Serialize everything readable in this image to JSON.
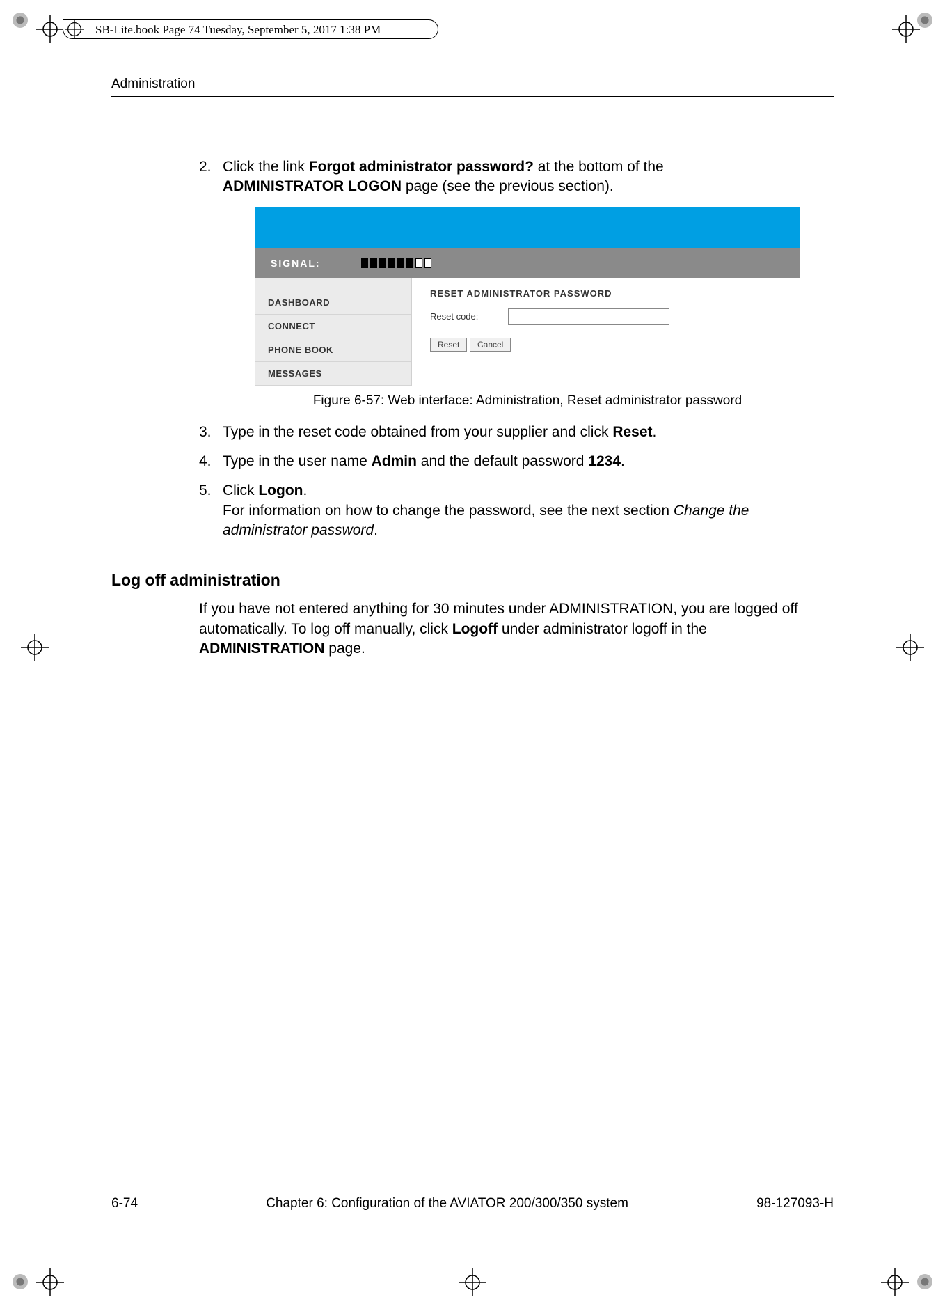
{
  "printMeta": {
    "tabText": "SB-Lite.book  Page 74  Tuesday, September 5, 2017  1:38 PM"
  },
  "header": {
    "runningHead": "Administration"
  },
  "steps": {
    "s2": {
      "num": "2.",
      "pre": "Click the link ",
      "bold1": "Forgot administrator password?",
      "mid": " at the bottom of the ",
      "bold2": "ADMINISTRATOR LOGON",
      "post": " page (see the previous section)."
    },
    "s3": {
      "num": "3.",
      "pre": "Type in the reset code obtained from your supplier and click ",
      "bold1": "Reset",
      "post": "."
    },
    "s4": {
      "num": "4.",
      "pre": "Type in the user name ",
      "bold1": "Admin",
      "mid": " and the default password ",
      "bold2": "1234",
      "post": "."
    },
    "s5": {
      "num": "5.",
      "pre": "Click ",
      "bold1": "Logon",
      "post1": ".",
      "para2a": "For information on how to change the password, see the next section ",
      "para2i": "Change the administrator password",
      "para2b": "."
    }
  },
  "figure": {
    "signalLabel": "SIGNAL:",
    "nav": [
      "DASHBOARD",
      "CONNECT",
      "PHONE BOOK",
      "MESSAGES"
    ],
    "mainTitle": "RESET ADMINISTRATOR PASSWORD",
    "resetLabel": "Reset code:",
    "btnReset": "Reset",
    "btnCancel": "Cancel",
    "caption": "Figure 6-57: Web interface: Administration, Reset administrator password"
  },
  "section": {
    "heading": "Log off administration",
    "paraA": "If you have not entered anything for 30 minutes under ADMINISTRATION, you are logged off automatically. To log off manually, click ",
    "paraBold1": "Logoff",
    "paraB": " under administrator logoff in the ",
    "paraBold2": "ADMINISTRATION",
    "paraC": " page."
  },
  "footer": {
    "pageNum": "6-74",
    "chapter": "Chapter 6:  Configuration of the AVIATOR 200/300/350 system",
    "docId": "98-127093-H"
  }
}
